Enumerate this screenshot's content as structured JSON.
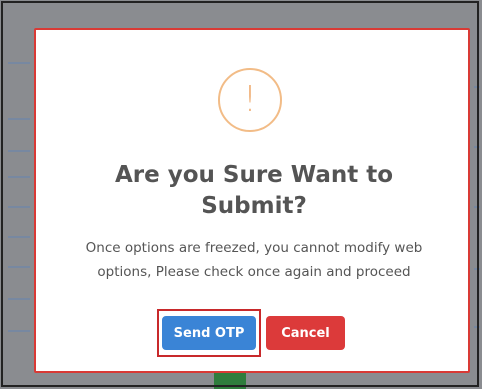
{
  "dialog": {
    "icon": "exclamation-icon",
    "icon_glyph": "!",
    "title": "Are you Sure Want to Submit?",
    "message": "Once options are freezed, you cannot modify web options, Please check once again and proceed",
    "buttons": {
      "send_otp": "Send OTP",
      "cancel": "Cancel"
    }
  },
  "colors": {
    "modal_border": "#d93a35",
    "warning_icon": "#f2bc87",
    "primary_button": "#3a84d6",
    "cancel_button": "#dc3a3a",
    "highlight": "#c8292b"
  }
}
